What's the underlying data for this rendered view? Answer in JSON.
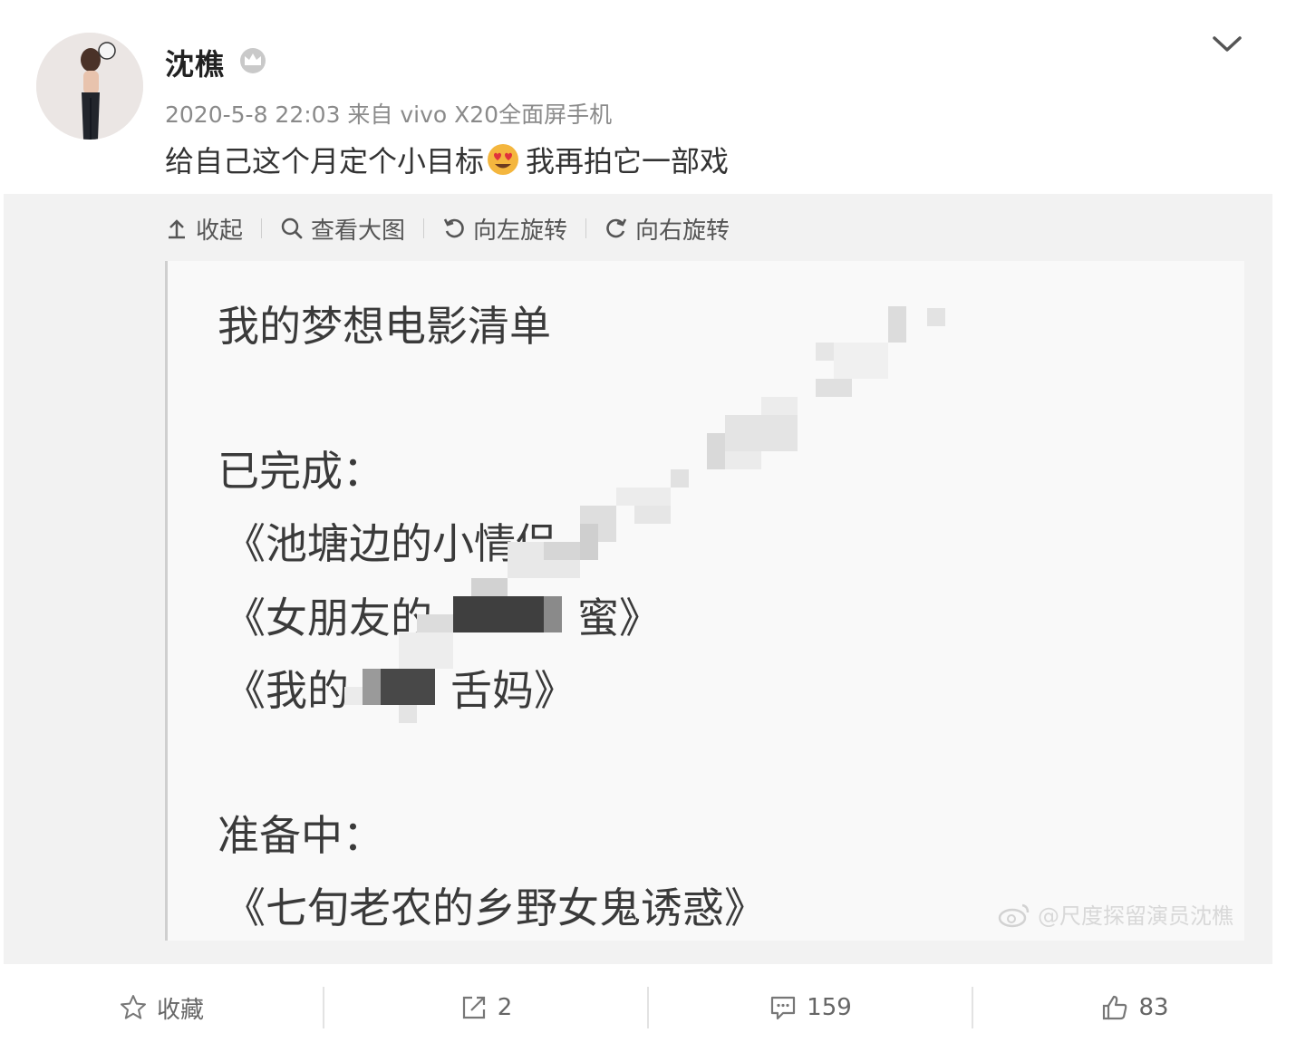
{
  "post": {
    "username": "沈樵",
    "meta": "2020-5-8 22:03 来自 vivo X20全面屏手机",
    "text_before": "给自己这个月定个小目标",
    "text_after": "我再拍它一部戏"
  },
  "toolbar": {
    "collapse": "收起",
    "view_large": "查看大图",
    "rotate_left": "向左旋转",
    "rotate_right": "向右旋转"
  },
  "image_note": {
    "title": "我的梦想电影清单",
    "done_label": "已完成：",
    "done_items": [
      "《池塘边的小情侣",
      "《女朋友的",
      "蜜》",
      "《我的",
      "舌妈》"
    ],
    "preparing_label": "准备中：",
    "preparing_item": "《七旬老农的乡野女鬼诱惑》",
    "watermark": "@尺度探留演员沈樵"
  },
  "actions": {
    "favorite": "收藏",
    "repost": "2",
    "comment": "159",
    "like": "83"
  },
  "colors": {
    "panel_bg": "#f2f2f2",
    "meta_text": "#8a8a8a"
  }
}
